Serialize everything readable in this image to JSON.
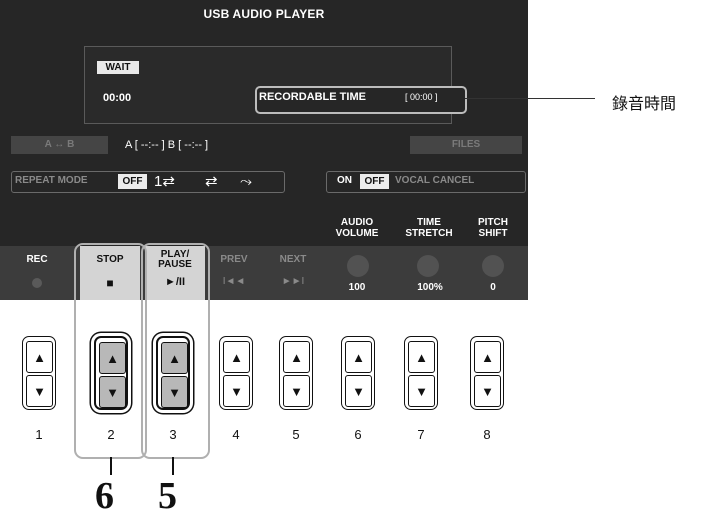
{
  "screen": {
    "title": "USB AUDIO PLAYER",
    "status_badge": "WAIT",
    "time": "00:00",
    "recordable_time_label": "RECORDABLE TIME",
    "recordable_time_value": "[ 00:00 ]",
    "ab_label": "A ↔ B",
    "ab_points": "A [ --:-- ]  B [ --:-- ]",
    "files_label": "FILES",
    "repeat_mode": {
      "label": "REPEAT MODE",
      "selected": "OFF",
      "options": [
        "OFF",
        "single-repeat-icon",
        "all-repeat-icon",
        "random-icon"
      ]
    },
    "vocal_cancel": {
      "on_label": "ON",
      "off_label": "OFF",
      "label": "VOCAL CANCEL",
      "selected": "OFF"
    },
    "knobs": [
      {
        "label_line1": "AUDIO",
        "label_line2": "VOLUME",
        "value": "100"
      },
      {
        "label_line1": "TIME",
        "label_line2": "STRETCH",
        "value": "100%"
      },
      {
        "label_line1": "PITCH",
        "label_line2": "SHIFT",
        "value": "0"
      }
    ],
    "softkeys": {
      "rec": "REC",
      "stop": "STOP",
      "stop_symbol": "■",
      "play_line1": "PLAY/",
      "play_line2": "PAUSE",
      "play_symbol": "►/II",
      "prev": "PREV",
      "prev_symbol": "I◄◄",
      "next": "NEXT",
      "next_symbol": "►►I"
    }
  },
  "buttons": {
    "numbers": [
      "1",
      "2",
      "3",
      "4",
      "5",
      "6",
      "7",
      "8"
    ],
    "up_symbol": "▲",
    "down_symbol": "▼"
  },
  "annotations": {
    "callout": "錄音時間",
    "step_stop": "6",
    "step_play": "5"
  },
  "colors": {
    "screen_bg": "#262626",
    "highlight_cell": "#d4d4d4",
    "outline": "#b0b0b0"
  }
}
